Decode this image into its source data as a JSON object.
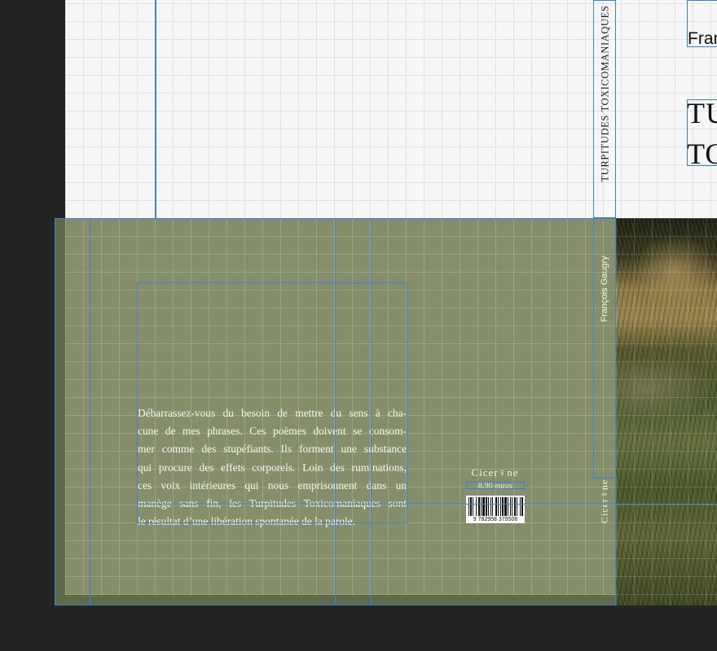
{
  "spine": {
    "title": "TURPITUDES TOXICOMANIAQUES",
    "author": "François Gaugry",
    "publisher_logo": "Cicer♀ne"
  },
  "back_cover": {
    "blurb_lines": [
      "Débarrassez-vous du besoin de mettre du sens à cha-",
      "cune de mes phrases. Ces poèmes doivent se consom-",
      "mer comme des stupéfiants. Ils forment une substance",
      "qui procure des effets corporels. Loin des ruminations,",
      "ces voix intérieures qui nous emprisonnent dans un",
      "manège sans fin, les Turpitudes Toxicomaniaques sont",
      "le résultat d’une libération spontanée de la parole."
    ],
    "publisher_logo": "Cicer♀ne",
    "price": "8,90 euros",
    "barcode_digits": "9  782958  379506"
  },
  "front_cover": {
    "author": "Fran",
    "title_line_1": "TU",
    "title_line_2": "TO"
  },
  "colors": {
    "cover_green": "#858e6a",
    "bleed_green": "#5f6a47",
    "frame_blue": "#3b82d9",
    "pasteboard": "#232323"
  }
}
